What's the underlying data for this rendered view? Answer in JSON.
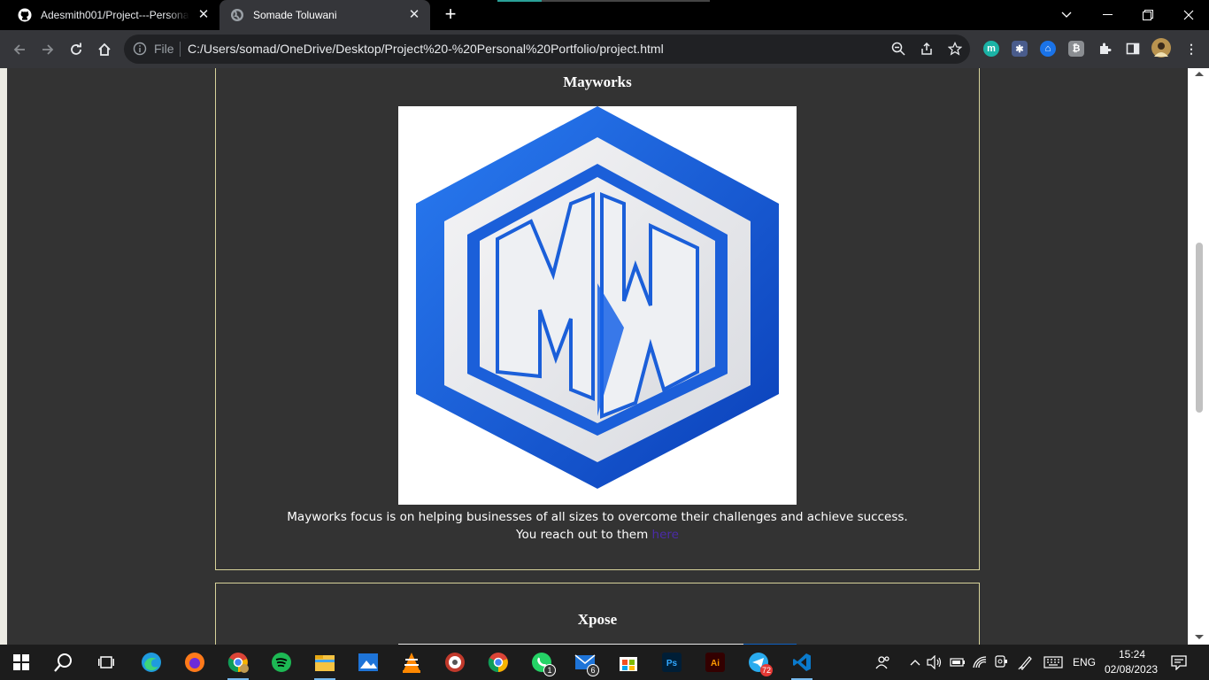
{
  "browser": {
    "tabs": [
      {
        "title": "Adesmith001/Project---Personal-Portfolio",
        "icon": "github-icon",
        "active": false
      },
      {
        "title": "Somade Toluwani",
        "icon": "globe-icon",
        "active": true
      }
    ],
    "address": {
      "scheme_label": "File",
      "url": "C:/Users/somad/OneDrive/Desktop/Project%20-%20Personal%20Portfolio/project.html"
    },
    "extensions": [
      "m-extension-icon",
      "puzzle-ext-icon",
      "blue-ext-icon",
      "gray-ext-icon",
      "extensions-icon",
      "side-panel-icon",
      "profile-avatar"
    ]
  },
  "page": {
    "projects": [
      {
        "name": "Mayworks",
        "logo_text": "MW",
        "description": "Mayworks focus is on helping businesses of all sizes to overcome their challenges and achieve success.",
        "cta_prefix": "You reach out to them",
        "cta_link": "here"
      },
      {
        "name": "Xpose"
      }
    ]
  },
  "taskbar": {
    "apps": [
      {
        "name": "edge",
        "badge": ""
      },
      {
        "name": "firefox",
        "badge": ""
      },
      {
        "name": "chrome-profile",
        "badge": ""
      },
      {
        "name": "spotify",
        "badge": ""
      },
      {
        "name": "file-explorer",
        "badge": ""
      },
      {
        "name": "photos",
        "badge": ""
      },
      {
        "name": "vlc",
        "badge": ""
      },
      {
        "name": "groove",
        "badge": ""
      },
      {
        "name": "chrome",
        "badge": ""
      },
      {
        "name": "whatsapp",
        "badge": "1"
      },
      {
        "name": "mail",
        "badge": "6"
      },
      {
        "name": "store",
        "badge": ""
      },
      {
        "name": "photoshop",
        "badge": ""
      },
      {
        "name": "illustrator",
        "badge": ""
      },
      {
        "name": "telegram",
        "badge": "72"
      },
      {
        "name": "vscode",
        "badge": ""
      }
    ],
    "language": "ENG",
    "time": "15:24",
    "date": "02/08/2023"
  },
  "colors": {
    "page_bg": "#333333",
    "card_border": "#d7d39a",
    "link": "#4b2ba8",
    "logo_blue": "#1763e6"
  }
}
